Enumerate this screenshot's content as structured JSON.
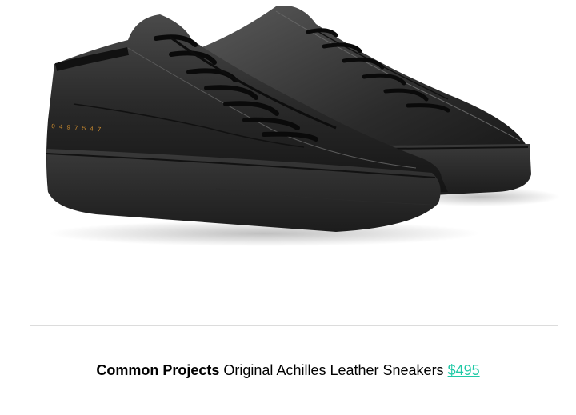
{
  "product": {
    "brand": "Common Projects",
    "name": "Original Achilles Leather Sneakers",
    "price": "$495",
    "heel_stamp": "0 4 9 7 5 4 7",
    "image_icon": "black-leather-sneakers-image"
  },
  "colors": {
    "price_link": "#20c9a6",
    "divider": "#dcdcdc",
    "heel_stamp": "#c8892e"
  }
}
